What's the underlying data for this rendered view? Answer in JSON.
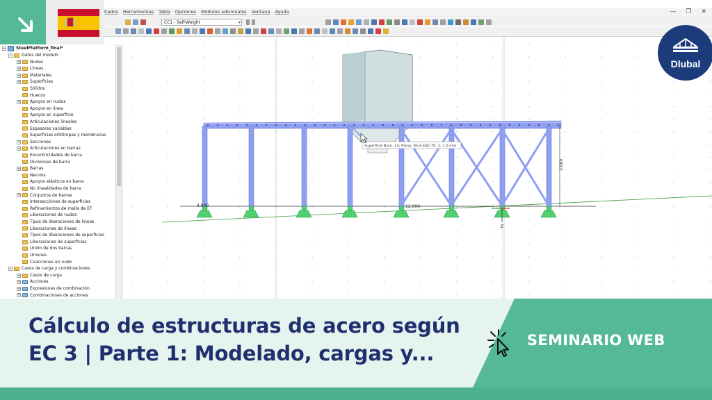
{
  "menu": {
    "items": [
      "ltados",
      "Herramientas",
      "Tabla",
      "Opciones",
      "Módulos adicionales",
      "Ventana",
      "Ayuda"
    ]
  },
  "window_controls": [
    "—",
    "❐",
    "✕"
  ],
  "toolbar": {
    "load_case": "CC1 - Self-Weight"
  },
  "navigator": {
    "root": "SteelPlatform_final*",
    "rows": [
      {
        "label": "Datos del modelo",
        "level": 1,
        "expander": "−",
        "icon": "folder"
      },
      {
        "label": "Nudos",
        "level": 2,
        "expander": "+",
        "icon": "folder"
      },
      {
        "label": "Líneas",
        "level": 2,
        "expander": "+",
        "icon": "folder"
      },
      {
        "label": "Materiales",
        "level": 2,
        "expander": "+",
        "icon": "folder"
      },
      {
        "label": "Superficies",
        "level": 2,
        "expander": "+",
        "icon": "folder"
      },
      {
        "label": "Sólidos",
        "level": 2,
        "expander": "",
        "icon": "folder"
      },
      {
        "label": "Huecos",
        "level": 2,
        "expander": "",
        "icon": "folder"
      },
      {
        "label": "Apoyos en nudos",
        "level": 2,
        "expander": "+",
        "icon": "folder"
      },
      {
        "label": "Apoyos en línea",
        "level": 2,
        "expander": "",
        "icon": "folder"
      },
      {
        "label": "Apoyos en superficie",
        "level": 2,
        "expander": "",
        "icon": "folder"
      },
      {
        "label": "Articulaciones lineales",
        "level": 2,
        "expander": "",
        "icon": "folder"
      },
      {
        "label": "Espesores variables",
        "level": 2,
        "expander": "",
        "icon": "folder"
      },
      {
        "label": "Superficies ortótropas y membranas",
        "level": 2,
        "expander": "",
        "icon": "folder"
      },
      {
        "label": "Secciones",
        "level": 2,
        "expander": "+",
        "icon": "folder"
      },
      {
        "label": "Articulaciones en barras",
        "level": 2,
        "expander": "+",
        "icon": "folder"
      },
      {
        "label": "Excentricidades de barra",
        "level": 2,
        "expander": "",
        "icon": "folder"
      },
      {
        "label": "Divisiones de barra",
        "level": 2,
        "expander": "",
        "icon": "folder"
      },
      {
        "label": "Barras",
        "level": 2,
        "expander": "+",
        "icon": "folder"
      },
      {
        "label": "Nervios",
        "level": 2,
        "expander": "",
        "icon": "folder"
      },
      {
        "label": "Apoyos elásticos en barra",
        "level": 2,
        "expander": "",
        "icon": "folder"
      },
      {
        "label": "No linealidades de barra",
        "level": 2,
        "expander": "",
        "icon": "folder"
      },
      {
        "label": "Conjuntos de barras",
        "level": 2,
        "expander": "+",
        "icon": "folder"
      },
      {
        "label": "Intersecciones de superficies",
        "level": 2,
        "expander": "",
        "icon": "folder"
      },
      {
        "label": "Refinamientos de malla de EF",
        "level": 2,
        "expander": "",
        "icon": "folder"
      },
      {
        "label": "Liberaciones de nudos",
        "level": 2,
        "expander": "",
        "icon": "folder"
      },
      {
        "label": "Tipos de liberaciones de líneas",
        "level": 2,
        "expander": "",
        "icon": "folder"
      },
      {
        "label": "Liberaciones de líneas",
        "level": 2,
        "expander": "",
        "icon": "folder"
      },
      {
        "label": "Tipos de liberaciones de superficies",
        "level": 2,
        "expander": "",
        "icon": "folder"
      },
      {
        "label": "Liberaciones de superficies",
        "level": 2,
        "expander": "",
        "icon": "folder"
      },
      {
        "label": "Unión de dos barras",
        "level": 2,
        "expander": "",
        "icon": "folder"
      },
      {
        "label": "Uniones",
        "level": 2,
        "expander": "",
        "icon": "folder"
      },
      {
        "label": "Coacciones en nudo",
        "level": 2,
        "expander": "",
        "icon": "folder"
      },
      {
        "label": "Casos de carga y combinaciones",
        "level": 1,
        "expander": "−",
        "icon": "folder"
      },
      {
        "label": "Casos de carga",
        "level": 2,
        "expander": "+",
        "icon": "folder"
      },
      {
        "label": "Acciones",
        "level": 2,
        "expander": "+",
        "icon": "alt"
      },
      {
        "label": "Expresiones de combinación",
        "level": 2,
        "expander": "+",
        "icon": "alt"
      },
      {
        "label": "Combinaciones de acciones",
        "level": 2,
        "expander": "+",
        "icon": "alt"
      }
    ]
  },
  "model_view": {
    "dimension_left": "4.000",
    "dimension_middle": "12.000",
    "dimension_height": "3.000",
    "axis_label": "Z",
    "tooltip": "Superficie Núm. 14: Plana; 85.6-€82.70; 2; 1.0 mm"
  },
  "branding": {
    "logo_text": "Dlubal",
    "webinar_label": "SEMINARIO WEB"
  },
  "banner": {
    "title_line1": "Cálculo de estructuras de acero según",
    "title_line2": "EC 3 | Parte 1: Modelado, cargas y..."
  },
  "colors": {
    "green": "#55b898",
    "banner_bg": "#e6f4ef",
    "navy": "#20306e",
    "logo": "#1c3b7b",
    "steel": "#8e9ef0",
    "support": "#52d070"
  }
}
